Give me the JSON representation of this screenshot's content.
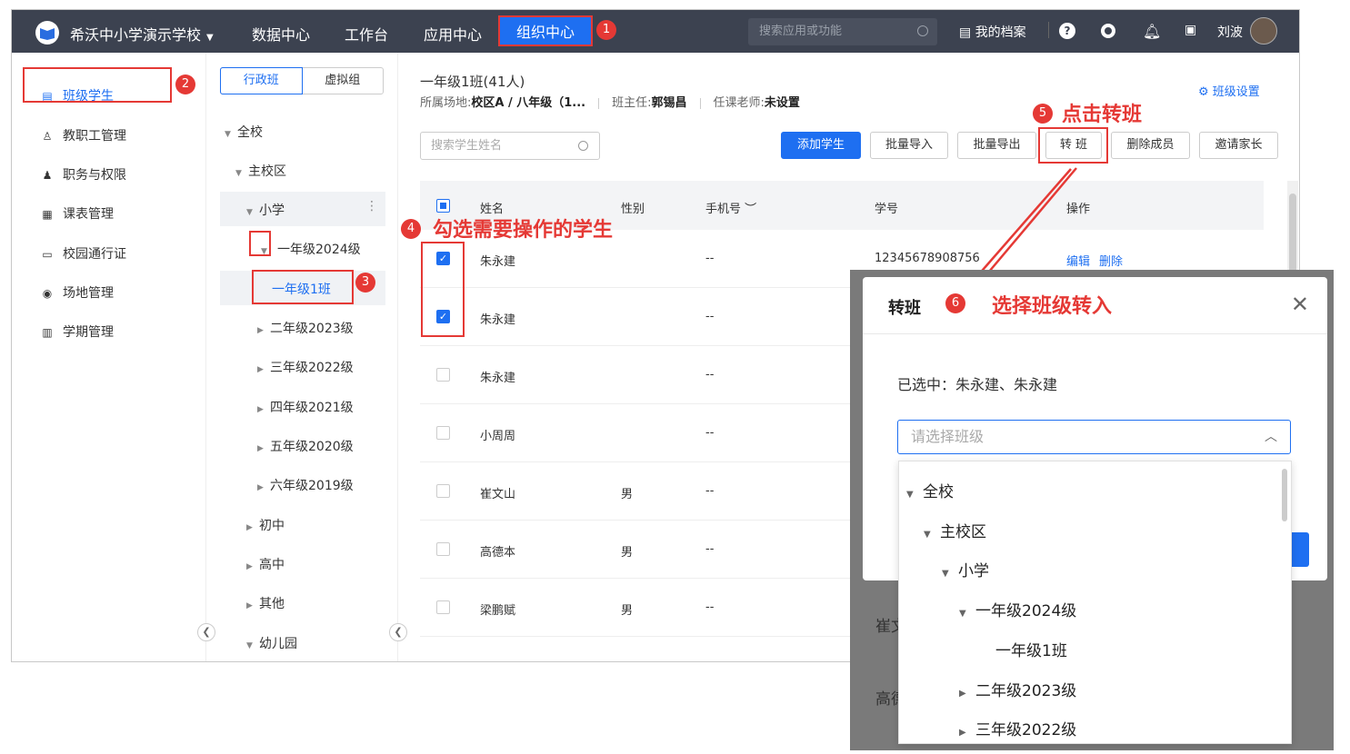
{
  "topbar": {
    "school": "希沃中小学演示学校",
    "nav": [
      "数据中心",
      "工作台",
      "应用中心",
      "组织中心"
    ],
    "search_placeholder": "搜索应用或功能",
    "archive": "我的档案",
    "user": "刘波"
  },
  "left_nav": [
    "班级学生",
    "教职工管理",
    "职务与权限",
    "课表管理",
    "校园通行证",
    "场地管理",
    "学期管理"
  ],
  "tree_panel": {
    "tabs": [
      "行政班",
      "虚拟组"
    ],
    "nodes": [
      "全校",
      "主校区",
      "小学",
      "一年级2024级",
      "一年级1班",
      "二年级2023级",
      "三年级2022级",
      "四年级2021级",
      "五年级2020级",
      "六年级2019级",
      "初中",
      "高中",
      "其他",
      "幼儿园"
    ]
  },
  "main": {
    "class_title": "一年级1班(41人)",
    "meta": {
      "location_label": "所属场地:",
      "location_value": "校区A / 八年级（1...",
      "head_label": "班主任:",
      "head_value": "郭锡昌",
      "teacher_label": "任课老师:",
      "teacher_value": "未设置"
    },
    "settings": "班级设置",
    "search_placeholder": "搜索学生姓名",
    "buttons": [
      "添加学生",
      "批量导入",
      "批量导出",
      "转 班",
      "删除成员",
      "邀请家长"
    ],
    "columns": [
      "姓名",
      "性别",
      "手机号",
      "学号",
      "操作"
    ],
    "rows": [
      {
        "name": "朱永建",
        "gender": "",
        "phone": "--",
        "id": "12345678908756",
        "checked": true
      },
      {
        "name": "朱永建",
        "gender": "",
        "phone": "--",
        "id": "",
        "checked": true
      },
      {
        "name": "朱永建",
        "gender": "",
        "phone": "--",
        "id": "",
        "checked": false
      },
      {
        "name": "小周周",
        "gender": "",
        "phone": "--",
        "id": "",
        "checked": false
      },
      {
        "name": "崔文山",
        "gender": "男",
        "phone": "--",
        "id": "",
        "checked": false
      },
      {
        "name": "高德本",
        "gender": "男",
        "phone": "--",
        "id": "",
        "checked": false
      },
      {
        "name": "梁鹏赋",
        "gender": "男",
        "phone": "--",
        "id": "",
        "checked": false
      }
    ],
    "ops": [
      "编辑",
      "删除"
    ]
  },
  "annotations": {
    "step4": "勾选需要操作的学生",
    "step5": "点击转班",
    "step6": "选择班级转入",
    "numbers": [
      "1",
      "2",
      "3",
      "4",
      "5",
      "6"
    ]
  },
  "modal": {
    "title": "转班",
    "selected_label": "已选中：朱永建、朱永建",
    "select_placeholder": "请选择班级",
    "dropdown": [
      "全校",
      "主校区",
      "小学",
      "一年级2024级",
      "一年级1班",
      "二年级2023级",
      "三年级2022级"
    ],
    "ghost_rows": [
      "崔文",
      "高德"
    ]
  },
  "colors": {
    "accent": "#1e6ff1",
    "annotation": "#e53935",
    "topbar": "#3c4250"
  }
}
